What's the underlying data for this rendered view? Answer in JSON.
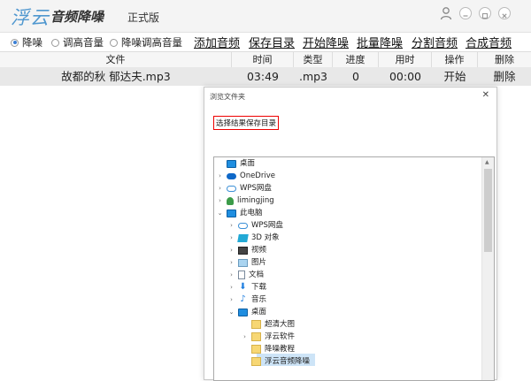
{
  "app": {
    "logo_text": "浮云",
    "name": "音频降噪",
    "edition": "正式版"
  },
  "modes": [
    {
      "label": "降噪",
      "selected": true
    },
    {
      "label": "调高音量",
      "selected": false
    },
    {
      "label": "降噪调高音量",
      "selected": false
    }
  ],
  "actions": [
    "添加音频",
    "保存目录",
    "开始降噪",
    "批量降噪",
    "分割音频",
    "合成音频"
  ],
  "table": {
    "columns": [
      "文件",
      "时间",
      "类型",
      "进度",
      "用时",
      "操作",
      "删除"
    ],
    "rows": [
      {
        "file": "故都的秋 郁达夫.mp3",
        "time": "03:49",
        "type": ".mp3",
        "progress": "0",
        "elapsed": "00:00",
        "op": "开始",
        "del": "删除"
      }
    ]
  },
  "dialog": {
    "title": "浏览文件夹",
    "close": "✕",
    "hint": "选择结果保存目录",
    "tree": [
      {
        "label": "桌面",
        "icon": "monitor-icon",
        "level": 0,
        "chevron": ""
      },
      {
        "label": "OneDrive",
        "icon": "onedrive-icon",
        "level": 1,
        "chevron": "›"
      },
      {
        "label": "WPS网盘",
        "icon": "cloud-icon",
        "level": 1,
        "chevron": "›"
      },
      {
        "label": "limingjing",
        "icon": "user-icon",
        "level": 1,
        "chevron": "›"
      },
      {
        "label": "此电脑",
        "icon": "monitor-icon",
        "level": 1,
        "chevron": "⌄"
      },
      {
        "label": "WPS网盘",
        "icon": "cloud-icon",
        "level": 2,
        "chevron": "›"
      },
      {
        "label": "3D 对象",
        "icon": "cube-icon",
        "level": 2,
        "chevron": "›"
      },
      {
        "label": "视频",
        "icon": "video-icon",
        "level": 2,
        "chevron": "›"
      },
      {
        "label": "图片",
        "icon": "picture-icon",
        "level": 2,
        "chevron": "›"
      },
      {
        "label": "文档",
        "icon": "document-icon",
        "level": 2,
        "chevron": "›"
      },
      {
        "label": "下载",
        "icon": "download-icon",
        "level": 2,
        "chevron": "›"
      },
      {
        "label": "音乐",
        "icon": "music-icon",
        "level": 2,
        "chevron": "›"
      },
      {
        "label": "桌面",
        "icon": "monitor-icon",
        "level": 2,
        "chevron": "⌄"
      },
      {
        "label": "超清大图",
        "icon": "folder-icon",
        "level": 3,
        "chevron": ""
      },
      {
        "label": "浮云软件",
        "icon": "folder-icon",
        "level": 3,
        "chevron": "›"
      },
      {
        "label": "降噪教程",
        "icon": "folder-icon",
        "level": 3,
        "chevron": ""
      },
      {
        "label": "浮云音频降噪",
        "icon": "folder-icon",
        "level": 3,
        "chevron": ""
      }
    ]
  }
}
